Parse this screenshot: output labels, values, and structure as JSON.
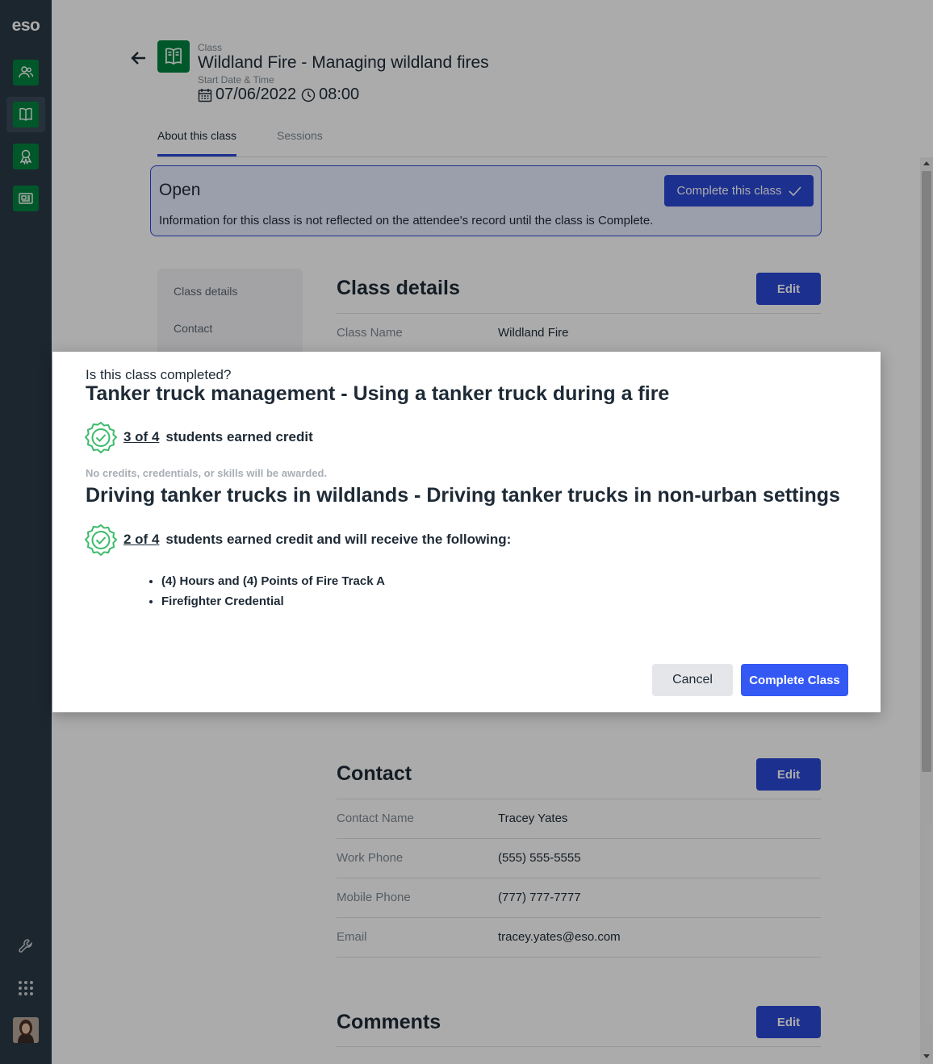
{
  "app": {
    "logo": "eso"
  },
  "sidebar": {
    "nav": [
      {
        "icon": "people-icon"
      },
      {
        "icon": "book-icon",
        "active": true
      },
      {
        "icon": "award-icon"
      },
      {
        "icon": "news-icon"
      }
    ],
    "tools": [
      {
        "icon": "wrench-icon"
      },
      {
        "icon": "apps-grid-icon"
      }
    ]
  },
  "header": {
    "class_label": "Class",
    "class_title": "Wildland Fire - Managing wildland fires",
    "start_label": "Start Date & Time",
    "date": "07/06/2022",
    "time": "08:00"
  },
  "tabs": [
    {
      "label": "About this class"
    },
    {
      "label": "Sessions"
    }
  ],
  "banner": {
    "status": "Open",
    "info": "Information for this class is not reflected on the attendee's record until the class is Complete.",
    "button_label": "Complete this class"
  },
  "side_menu": [
    {
      "label": "Class details"
    },
    {
      "label": "Contact"
    }
  ],
  "class_details": {
    "title": "Class details",
    "edit_label": "Edit",
    "fields": [
      {
        "label": "Class Name",
        "value": "Wildland Fire"
      }
    ]
  },
  "contact": {
    "title": "Contact",
    "edit_label": "Edit",
    "fields": [
      {
        "label": "Contact Name",
        "value": "Tracey Yates"
      },
      {
        "label": "Work Phone",
        "value": "(555) 555-5555"
      },
      {
        "label": "Mobile Phone",
        "value": "(777) 777-7777"
      },
      {
        "label": "Email",
        "value": "tracey.yates@eso.com"
      }
    ]
  },
  "comments": {
    "title": "Comments",
    "edit_label": "Edit"
  },
  "modal": {
    "question": "Is this class completed?",
    "sections": [
      {
        "heading": "Tanker truck management - Using a tanker truck during a fire",
        "count": "3 of 4",
        "credit_text": "students earned credit"
      },
      {
        "heading": "Driving tanker trucks in wildlands - Driving tanker trucks in non-urban settings",
        "count": "2 of 4",
        "credit_text": "students earned credit and will receive the following:",
        "awards": [
          "(4) Hours and (4) Points of Fire Track A",
          "Firefighter Credential"
        ]
      }
    ],
    "no_credits_note": "No credits, credentials, or skills will be awarded.",
    "cancel_label": "Cancel",
    "confirm_label": "Complete Class"
  },
  "colors": {
    "brand_green": "#00833f",
    "primary_blue": "#2a48d6",
    "sidebar": "#2b3a47",
    "credit_green": "#3dbb6b"
  }
}
